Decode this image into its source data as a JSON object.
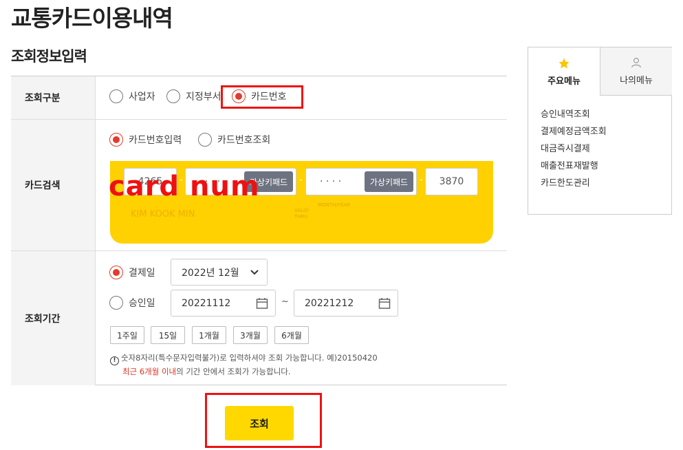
{
  "page_title": "교통카드이용내역",
  "section_title": "조회정보입력",
  "form": {
    "query_type": {
      "label": "조회구분",
      "options": [
        "사업자",
        "지정부서",
        "카드번호"
      ],
      "selected": "카드번호"
    },
    "card_search": {
      "label": "카드검색",
      "options": [
        "카드번호입력",
        "카드번호조회"
      ],
      "selected": "카드번호입력",
      "card_fields": [
        "4265",
        "· · · ·",
        "· · · ·",
        "3870"
      ],
      "virtual_keypad_label": "가상키패드",
      "separator": "-",
      "holder_name": "KIM KOOK MIN",
      "valid_label": "VALID\nTHRU",
      "month_year_label": "MONTH/YEAR"
    },
    "period": {
      "label": "조회기간",
      "options": [
        "결제일",
        "승인일"
      ],
      "selected": "결제일",
      "payment_month": "2022년 12월",
      "approval_from": "20221112",
      "approval_to": "20221212",
      "tilde": "~",
      "quick_ranges": [
        "1주일",
        "15일",
        "1개월",
        "3개월",
        "6개월"
      ],
      "note_line1": "숫자8자리(특수문자입력불가)로 입력하셔야 조회 가능합니다. 예)20150420",
      "note_line2_red": "최근 6개월 이내",
      "note_line2_rest": "의 기간 안에서 조회가 가능합니다.",
      "info_icon": "!"
    }
  },
  "annotation_text": "card num",
  "submit_label": "조회",
  "sidebar": {
    "tabs": [
      {
        "label": "주요메뉴",
        "icon": "star-icon",
        "active": true
      },
      {
        "label": "나의메뉴",
        "icon": "person-icon",
        "active": false
      }
    ],
    "items": [
      "승인내역조회",
      "결제예정금액조회",
      "대금즉시결제",
      "매출전표재발행",
      "카드한도관리"
    ]
  },
  "colors": {
    "accent_yellow": "#ffd100",
    "radio_red": "#e23b2e",
    "annotation_red": "#ee1111",
    "keypad_gray": "#6e7381"
  }
}
